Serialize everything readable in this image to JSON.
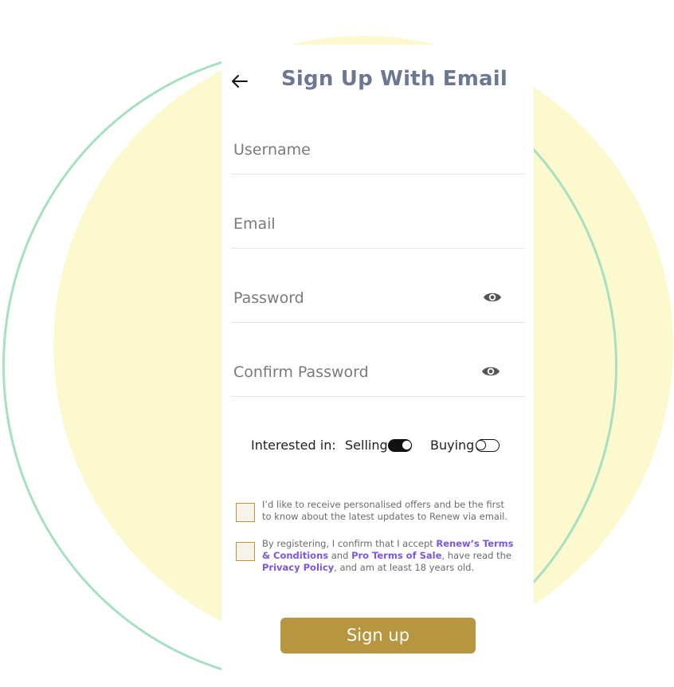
{
  "header": {
    "title": "Sign Up With Email",
    "back_icon": "arrow-left-icon"
  },
  "form": {
    "username": {
      "placeholder": "Username",
      "value": ""
    },
    "email": {
      "placeholder": "Email",
      "value": ""
    },
    "password": {
      "placeholder": "Password",
      "value": "",
      "toggle_icon": "eye-icon"
    },
    "confirm_password": {
      "placeholder": "Confirm Password",
      "value": "",
      "toggle_icon": "eye-icon"
    }
  },
  "interests": {
    "label": "Interested in:",
    "options": [
      {
        "label": "Selling",
        "state": "on"
      },
      {
        "label": "Buying",
        "state": "off"
      }
    ]
  },
  "consents": {
    "offers_text": "I’d like to receive personalised offers and be the first to know about the latest updates to Renew via email.",
    "terms_prefix": "By registering, I confirm that I accept ",
    "terms_link1": "Renew’s Terms & Conditions",
    "terms_mid1": " and ",
    "terms_link2": "Pro Terms of Sale",
    "terms_mid2": ", have read the ",
    "terms_link3": "Privacy Policy",
    "terms_suffix": ", and am at least 18 years old."
  },
  "actions": {
    "signup_label": "Sign up"
  },
  "colors": {
    "title": "#6c7891",
    "accent_gold": "#b8953f",
    "link_purple": "#7b55e6",
    "bg_yellow": "#fcf9cf",
    "ring_green": "#a7e0c1"
  }
}
